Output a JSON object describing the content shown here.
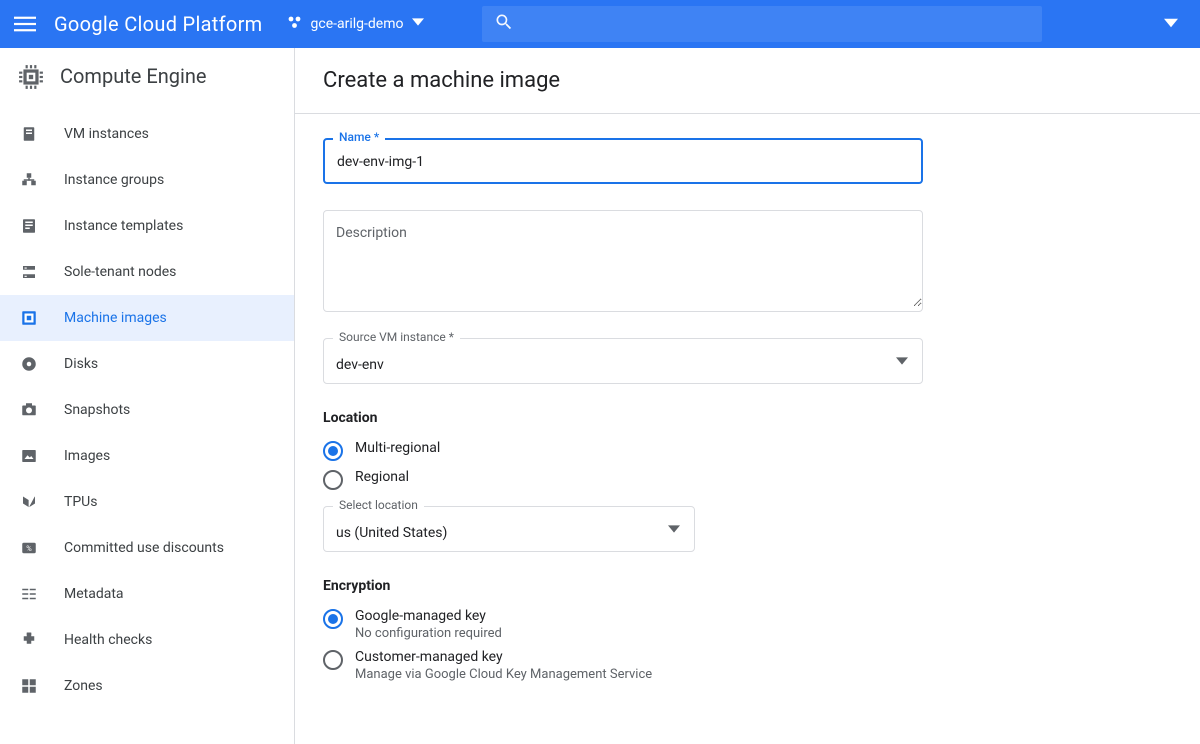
{
  "header": {
    "brand": "Google Cloud Platform",
    "project": "gce-arilg-demo",
    "search_placeholder": ""
  },
  "product_title": "Compute Engine",
  "sidebar": {
    "items": [
      {
        "icon": "vm-instances-icon",
        "label": "VM instances"
      },
      {
        "icon": "instance-groups-icon",
        "label": "Instance groups"
      },
      {
        "icon": "instance-templates-icon",
        "label": "Instance templates"
      },
      {
        "icon": "sole-tenant-icon",
        "label": "Sole-tenant nodes"
      },
      {
        "icon": "machine-images-icon",
        "label": "Machine images"
      },
      {
        "icon": "disks-icon",
        "label": "Disks"
      },
      {
        "icon": "snapshots-icon",
        "label": "Snapshots"
      },
      {
        "icon": "images-icon",
        "label": "Images"
      },
      {
        "icon": "tpus-icon",
        "label": "TPUs"
      },
      {
        "icon": "committed-discounts-icon",
        "label": "Committed use discounts"
      },
      {
        "icon": "metadata-icon",
        "label": "Metadata"
      },
      {
        "icon": "health-checks-icon",
        "label": "Health checks"
      },
      {
        "icon": "zones-icon",
        "label": "Zones"
      }
    ],
    "active_index": 4
  },
  "page": {
    "title": "Create a machine image",
    "name_label": "Name *",
    "name_value": "dev-env-img-1",
    "description_placeholder": "Description",
    "description_value": "",
    "source_label": "Source VM instance *",
    "source_value": "dev-env",
    "location_heading": "Location",
    "location_options": [
      "Multi-regional",
      "Regional"
    ],
    "location_selected": 0,
    "select_location_label": "Select location",
    "select_location_value": "us (United States)",
    "encryption_heading": "Encryption",
    "encryption_options": [
      {
        "label": "Google-managed key",
        "sub": "No configuration required"
      },
      {
        "label": "Customer-managed key",
        "sub": "Manage via Google Cloud Key Management Service"
      }
    ],
    "encryption_selected": 0
  }
}
